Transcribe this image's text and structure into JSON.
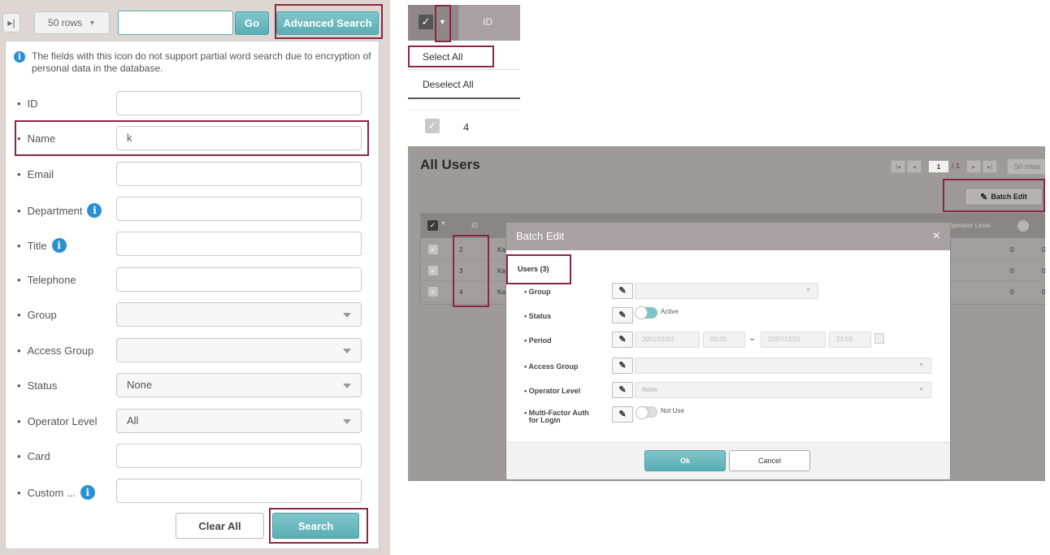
{
  "toolbar": {
    "rows_label": "50 rows",
    "search_value": "",
    "go_label": "Go",
    "advanced_label": "Advanced Search",
    "last_page_glyph": "▸|"
  },
  "advanced_search": {
    "notice": "The fields with this icon do not support partial word search due to encryption of personal data in the database.",
    "info_glyph": "i",
    "fields": [
      {
        "label": "ID",
        "kind": "text",
        "value": "",
        "info": false
      },
      {
        "label": "Name",
        "kind": "text",
        "value": "k",
        "info": false
      },
      {
        "label": "Email",
        "kind": "text",
        "value": "",
        "info": false
      },
      {
        "label": "Department",
        "kind": "text",
        "value": "",
        "info": true
      },
      {
        "label": "Title",
        "kind": "text",
        "value": "",
        "info": true
      },
      {
        "label": "Telephone",
        "kind": "text",
        "value": "",
        "info": false
      },
      {
        "label": "Group",
        "kind": "select",
        "value": "",
        "info": false
      },
      {
        "label": "Access Group",
        "kind": "select",
        "value": "",
        "info": false
      },
      {
        "label": "Status",
        "kind": "select",
        "value": "None",
        "info": false
      },
      {
        "label": "Operator Level",
        "kind": "select",
        "value": "All",
        "info": false
      },
      {
        "label": "Card",
        "kind": "text",
        "value": "",
        "info": false
      },
      {
        "label": "Custom ...",
        "kind": "text",
        "value": "",
        "info": true
      }
    ],
    "clear_label": "Clear All",
    "search_label": "Search"
  },
  "select_dropdown": {
    "column_header": "ID",
    "options": [
      "Select All",
      "Deselect All"
    ],
    "row_value": "4",
    "check_glyph": "✓"
  },
  "users_page": {
    "title": "All Users",
    "pager": {
      "current": "1",
      "total": "/ 1",
      "rows": "50 rows",
      "first": "|◂",
      "prev": "◂",
      "next": "▸",
      "last": "▸|"
    },
    "batch_edit_button": "Batch Edit",
    "pencil_glyph": "✎",
    "table": {
      "id_header": "ID",
      "operator_header": "Operator Level",
      "rows": [
        {
          "id": "2",
          "name": "Ka",
          "a": "0",
          "b": "0"
        },
        {
          "id": "3",
          "name": "Ka",
          "a": "0",
          "b": "0"
        },
        {
          "id": "4",
          "name": "Ka",
          "a": "0",
          "b": "0"
        }
      ]
    },
    "modal": {
      "title": "Batch Edit",
      "close_glyph": "×",
      "users_count": "Users (3)",
      "rows": {
        "group": "Group",
        "status": "Status",
        "status_value": "Active",
        "period": "Period",
        "period_start": "2001/01/01",
        "period_start_time": "00:00",
        "period_sep": "~",
        "period_end": "2037/12/31",
        "period_end_time": "23:59",
        "access_group": "Access Group",
        "operator_level": "Operator Level",
        "operator_value": "None",
        "mfa": "Multi-Factor Auth for Login",
        "mfa_value": "Not Use"
      },
      "ok_label": "Ok",
      "cancel_label": "Cancel"
    }
  },
  "colors": {
    "teal": "#5aaeb4",
    "highlight": "#8c2743",
    "info": "#2b8fd6"
  }
}
